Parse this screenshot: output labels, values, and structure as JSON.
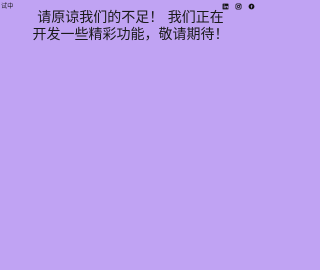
{
  "topbar": {
    "status_text": "试中",
    "social_links": [
      {
        "icon": "linkedin-icon"
      },
      {
        "icon": "instagram-icon"
      },
      {
        "icon": "facebook-icon"
      }
    ]
  },
  "message": {
    "line1": "请原谅我们的不足！ 我们正在",
    "line2": "开发一些精彩功能，敬请期待！"
  },
  "colors": {
    "background": "#c0a3f3",
    "text": "#1a1a1a"
  }
}
